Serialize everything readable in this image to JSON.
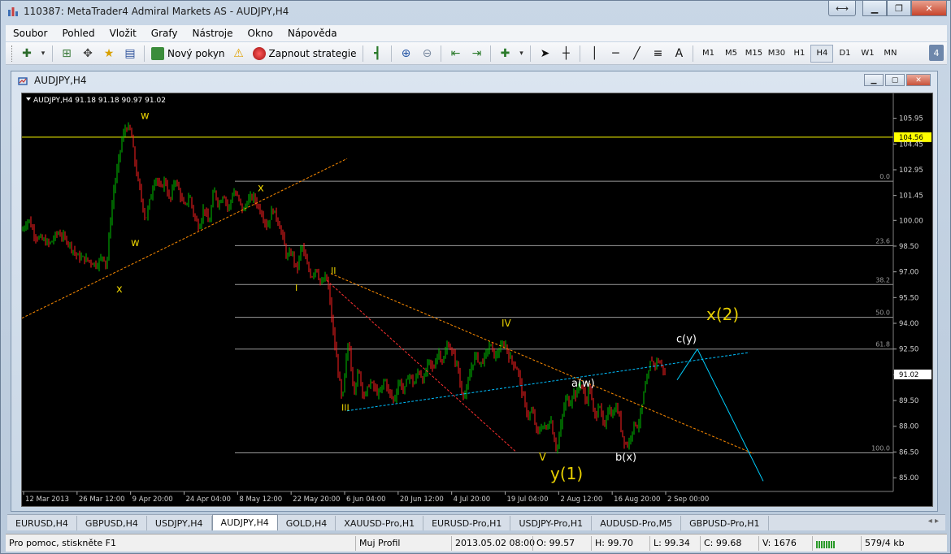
{
  "window": {
    "title": "110387: MetaTrader4 Admiral Markets AS - AUDJPY,H4"
  },
  "menu": [
    "Soubor",
    "Pohled",
    "Vložit",
    "Grafy",
    "Nástroje",
    "Okno",
    "Nápověda"
  ],
  "toolbar": {
    "new_order_label": "Nový pokyn",
    "start_strategy_label": "Zapnout strategie",
    "text_tool_label": "A",
    "timeframes": [
      "M1",
      "M5",
      "M15",
      "M30",
      "H1",
      "H4",
      "D1",
      "W1",
      "MN"
    ],
    "active_timeframe": "H4",
    "help_badge": "4"
  },
  "chart_window": {
    "title": "AUDJPY,H4"
  },
  "chart_data": {
    "type": "candlestick",
    "symbol_info": "AUDJPY,H4  91.18 91.18 90.97 91.02",
    "ylim": [
      84.2,
      107.4
    ],
    "price_ticks": [
      "105.95",
      "104.45",
      "102.95",
      "101.45",
      "100.00",
      "98.50",
      "97.00",
      "95.50",
      "94.00",
      "92.50",
      "91.00",
      "89.50",
      "88.00",
      "86.50",
      "85.00"
    ],
    "price_tick_values": [
      105.95,
      104.45,
      102.95,
      101.45,
      100.0,
      98.5,
      97.0,
      95.5,
      94.0,
      92.5,
      91.0,
      89.5,
      88.0,
      86.5,
      85.0
    ],
    "time_ticks": [
      "12 Mar 2013",
      "26 Mar 12:00",
      "9 Apr 20:00",
      "24 Apr 04:00",
      "8 May 12:00",
      "22 May 20:00",
      "6 Jun 04:00",
      "20 Jun 12:00",
      "4 Jul 20:00",
      "19 Jul 04:00",
      "2 Aug 12:00",
      "16 Aug 20:00",
      "2 Sep 00:00"
    ],
    "horizontal_line": {
      "price": 104.85,
      "label": "104.56",
      "color": "#ffff00"
    },
    "current_price": {
      "price": 91.02,
      "label": "91.02"
    },
    "fibonacci": [
      {
        "label": "0.0",
        "price": 102.28
      },
      {
        "label": "23.6",
        "price": 98.53
      },
      {
        "label": "38.2",
        "price": 96.26
      },
      {
        "label": "50.0",
        "price": 94.35
      },
      {
        "label": "61.8",
        "price": 92.5
      },
      {
        "label": "100.0",
        "price": 86.45
      }
    ],
    "price_path": [
      [
        0,
        99.4
      ],
      [
        8,
        100.1
      ],
      [
        16,
        99.1
      ],
      [
        24,
        98.9
      ],
      [
        34,
        98.6
      ],
      [
        44,
        99.3
      ],
      [
        56,
        98.8
      ],
      [
        68,
        97.9
      ],
      [
        80,
        97.7
      ],
      [
        92,
        97.4
      ],
      [
        100,
        98.0
      ],
      [
        104,
        97.2
      ],
      [
        108,
        99.6
      ],
      [
        113,
        101.8
      ],
      [
        118,
        103.2
      ],
      [
        123,
        104.7
      ],
      [
        128,
        105.5
      ],
      [
        134,
        105.2
      ],
      [
        140,
        103.0
      ],
      [
        146,
        101.5
      ],
      [
        152,
        100.0
      ],
      [
        158,
        101.3
      ],
      [
        164,
        102.6
      ],
      [
        170,
        101.8
      ],
      [
        176,
        102.4
      ],
      [
        182,
        101.0
      ],
      [
        188,
        102.5
      ],
      [
        194,
        101.6
      ],
      [
        200,
        100.7
      ],
      [
        206,
        101.5
      ],
      [
        212,
        100.2
      ],
      [
        218,
        99.6
      ],
      [
        224,
        100.8
      ],
      [
        230,
        99.7
      ],
      [
        236,
        101.8
      ],
      [
        242,
        100.9
      ],
      [
        248,
        101.6
      ],
      [
        254,
        100.6
      ],
      [
        260,
        101.7
      ],
      [
        266,
        101.3
      ],
      [
        272,
        100.5
      ],
      [
        278,
        101.2
      ],
      [
        284,
        101.4
      ],
      [
        290,
        100.9
      ],
      [
        296,
        100.3
      ],
      [
        302,
        99.6
      ],
      [
        308,
        100.7
      ],
      [
        314,
        100.1
      ],
      [
        320,
        99.2
      ],
      [
        326,
        97.8
      ],
      [
        332,
        98.2
      ],
      [
        338,
        97.0
      ],
      [
        344,
        98.6
      ],
      [
        350,
        97.5
      ],
      [
        356,
        96.7
      ],
      [
        362,
        97.3
      ],
      [
        368,
        96.2
      ],
      [
        374,
        96.8
      ],
      [
        378,
        95.7
      ],
      [
        382,
        93.8
      ],
      [
        386,
        92.3
      ],
      [
        390,
        90.9
      ],
      [
        394,
        89.3
      ],
      [
        398,
        91.5
      ],
      [
        402,
        93.1
      ],
      [
        406,
        91.0
      ],
      [
        410,
        89.8
      ],
      [
        414,
        91.6
      ],
      [
        418,
        90.2
      ],
      [
        422,
        89.7
      ],
      [
        428,
        90.6
      ],
      [
        434,
        90.2
      ],
      [
        440,
        89.8
      ],
      [
        446,
        90.8
      ],
      [
        452,
        89.9
      ],
      [
        458,
        89.5
      ],
      [
        464,
        90.7
      ],
      [
        470,
        90.0
      ],
      [
        476,
        91.1
      ],
      [
        482,
        90.4
      ],
      [
        488,
        91.3
      ],
      [
        494,
        90.6
      ],
      [
        500,
        91.8
      ],
      [
        506,
        91.3
      ],
      [
        512,
        92.4
      ],
      [
        518,
        91.7
      ],
      [
        524,
        92.9
      ],
      [
        530,
        92.2
      ],
      [
        536,
        91.5
      ],
      [
        540,
        90.1
      ],
      [
        546,
        89.8
      ],
      [
        552,
        91.3
      ],
      [
        558,
        92.2
      ],
      [
        564,
        91.6
      ],
      [
        570,
        92.1
      ],
      [
        576,
        92.8
      ],
      [
        582,
        92.0
      ],
      [
        588,
        92.5
      ],
      [
        594,
        92.9
      ],
      [
        598,
        92.2
      ],
      [
        604,
        91.7
      ],
      [
        610,
        91.3
      ],
      [
        616,
        89.8
      ],
      [
        622,
        88.6
      ],
      [
        628,
        88.9
      ],
      [
        634,
        87.5
      ],
      [
        640,
        88.1
      ],
      [
        646,
        87.8
      ],
      [
        650,
        88.6
      ],
      [
        654,
        87.4
      ],
      [
        658,
        86.6
      ],
      [
        662,
        87.7
      ],
      [
        666,
        88.9
      ],
      [
        670,
        89.8
      ],
      [
        674,
        89.2
      ],
      [
        678,
        90.1
      ],
      [
        682,
        89.7
      ],
      [
        686,
        90.6
      ],
      [
        690,
        90.2
      ],
      [
        694,
        89.3
      ],
      [
        698,
        90.5
      ],
      [
        702,
        89.1
      ],
      [
        706,
        88.4
      ],
      [
        710,
        89.6
      ],
      [
        714,
        88.2
      ],
      [
        718,
        87.9
      ],
      [
        722,
        89.4
      ],
      [
        726,
        88.5
      ],
      [
        730,
        89.2
      ],
      [
        734,
        88.8
      ],
      [
        738,
        87.6
      ],
      [
        742,
        87.0
      ],
      [
        746,
        86.9
      ],
      [
        750,
        87.7
      ],
      [
        754,
        88.2
      ],
      [
        758,
        88.0
      ],
      [
        762,
        88.9
      ],
      [
        766,
        90.2
      ],
      [
        770,
        90.8
      ],
      [
        774,
        92.0
      ],
      [
        778,
        91.5
      ],
      [
        782,
        91.9
      ],
      [
        786,
        91.6
      ],
      [
        790,
        91.2
      ],
      [
        792,
        91.02
      ]
    ],
    "price_x_end": 792,
    "trendlines": [
      {
        "name": "support-line-x",
        "color": "#ff8c00",
        "x1": 0,
        "p1": 94.3,
        "x2": 400,
        "p2": 103.6
      },
      {
        "name": "resistance-line",
        "color": "#ff8c00",
        "x1": 380,
        "p1": 96.9,
        "x2": 900,
        "p2": 86.4
      },
      {
        "name": "wave-iii-channel",
        "color": "#00bfff",
        "x1": 400,
        "p1": 88.9,
        "x2": 895,
        "p2": 92.3
      },
      {
        "name": "wave-ii-decline",
        "color": "#ff3030",
        "x1": 375,
        "p1": 96.5,
        "x2": 608,
        "p2": 86.5
      },
      {
        "name": "projection-up",
        "color": "#00d0ff",
        "x1": 806,
        "p1": 90.7,
        "x2": 831,
        "p2": 92.5
      },
      {
        "name": "projection-down",
        "color": "#00d0ff",
        "x1": 831,
        "p1": 92.5,
        "x2": 912,
        "p2": 84.8
      }
    ],
    "wave_labels": [
      {
        "text": "w",
        "x": 146,
        "p": 105.9,
        "color": "#e8d000",
        "size": 13
      },
      {
        "text": "w",
        "x": 134,
        "p": 98.5,
        "color": "#e8d000",
        "size": 13
      },
      {
        "text": "x",
        "x": 116,
        "p": 95.8,
        "color": "#e8d000",
        "size": 13
      },
      {
        "text": "x",
        "x": 290,
        "p": 101.7,
        "color": "#e8d000",
        "size": 13
      },
      {
        "text": "I",
        "x": 336,
        "p": 95.9,
        "color": "#e8d000",
        "size": 11
      },
      {
        "text": "II",
        "x": 380,
        "p": 96.9,
        "color": "#e8d000",
        "size": 11
      },
      {
        "text": "III",
        "x": 393,
        "p": 88.9,
        "color": "#e8d000",
        "size": 11
      },
      {
        "text": "IV",
        "x": 590,
        "p": 93.8,
        "color": "#e8d000",
        "size": 12
      },
      {
        "text": "V",
        "x": 636,
        "p": 86.0,
        "color": "#e8d000",
        "size": 13
      },
      {
        "text": "y(1)",
        "x": 650,
        "p": 84.9,
        "color": "#e8d000",
        "size": 20
      },
      {
        "text": "a(w)",
        "x": 676,
        "p": 90.3,
        "color": "#ffffff",
        "size": 13
      },
      {
        "text": "b(x)",
        "x": 730,
        "p": 86.0,
        "color": "#ffffff",
        "size": 13
      },
      {
        "text": "c(y)",
        "x": 805,
        "p": 92.9,
        "color": "#ffffff",
        "size": 13
      },
      {
        "text": "x(2)",
        "x": 842,
        "p": 94.2,
        "color": "#e8d000",
        "size": 20
      }
    ]
  },
  "tabs": [
    "EURUSD,H4",
    "GBPUSD,H4",
    "USDJPY,H4",
    "AUDJPY,H4",
    "GOLD,H4",
    "XAUUSD-Pro,H1",
    "EURUSD-Pro,H1",
    "USDJPY-Pro,H1",
    "AUDUSD-Pro,M5",
    "GBPUSD-Pro,H1"
  ],
  "active_tab": "AUDJPY,H4",
  "status": {
    "help": "Pro pomoc, stiskněte F1",
    "profile": "Muj Profil",
    "datetime": "2013.05.02 08:00",
    "open": "O: 99.57",
    "high": "H: 99.70",
    "low": "L: 99.34",
    "close": "C: 99.68",
    "volume": "V: 1676",
    "traffic": "579/4 kb"
  },
  "colors": {
    "bull": "#00c000",
    "bear": "#ff2020",
    "grid": "#2a2a2a",
    "axis_text": "#d0d0d0",
    "fib_line": "#9a9a9a"
  }
}
